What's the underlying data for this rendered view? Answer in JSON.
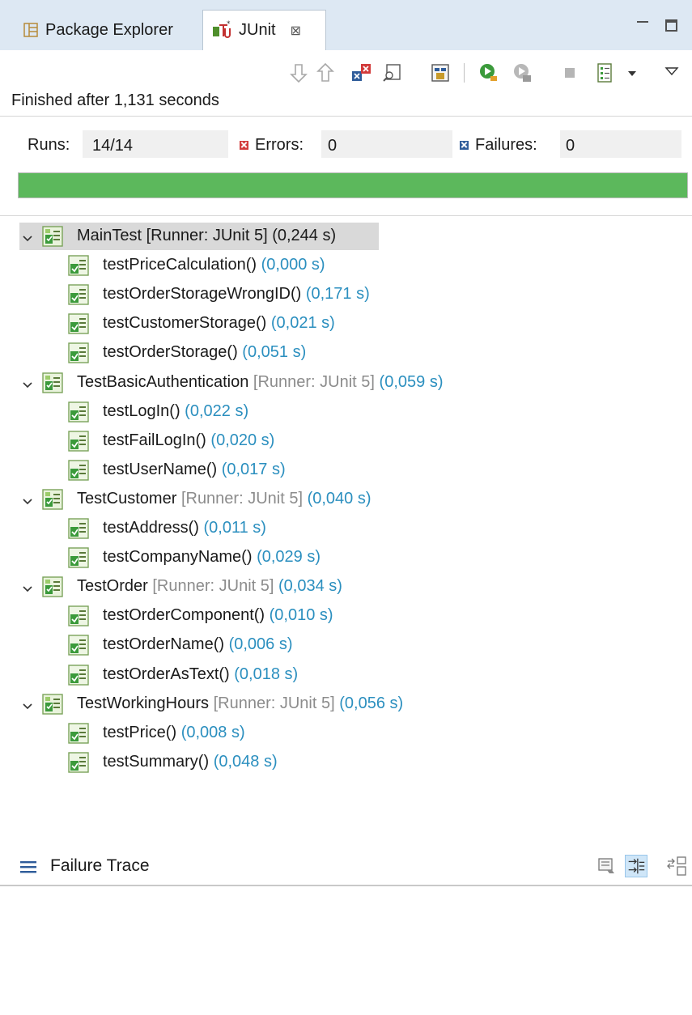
{
  "tabs": {
    "package_explorer": "Package Explorer",
    "junit": "JUnit"
  },
  "status": "Finished after 1,131 seconds",
  "counters": {
    "runs_label": "Runs:",
    "runs_value": "14/14",
    "errors_label": "Errors:",
    "errors_value": "0",
    "failures_label": "Failures:",
    "failures_value": "0"
  },
  "progress": {
    "fraction": 1.0,
    "color": "#5cb85c"
  },
  "colors": {
    "tab_bar": "#dde8f3",
    "duration": "#2b8fbf",
    "runner": "#8c8c8c",
    "error_mark": "#d23a3a",
    "failure_mark": "#2f5c9a"
  },
  "toolbar_icons": [
    "next-failure-icon",
    "previous-failure-icon",
    "show-failures-only-icon",
    "scroll-lock-icon",
    "show-skipped-icon",
    "rerun-test-icon",
    "rerun-failed-first-icon",
    "stop-icon",
    "test-run-history-icon",
    "history-dropdown-icon",
    "view-menu-icon"
  ],
  "tree": [
    {
      "name": "MainTest [Runner: JUnit 5]",
      "time": "(0,244 s)",
      "selected": true,
      "runner_plain": true,
      "cases": [
        {
          "name": "testPriceCalculation()",
          "time": "(0,000 s)"
        },
        {
          "name": "testOrderStorageWrongID()",
          "time": "(0,171 s)"
        },
        {
          "name": "testCustomerStorage()",
          "time": "(0,021 s)"
        },
        {
          "name": "testOrderStorage()",
          "time": "(0,051 s)"
        }
      ]
    },
    {
      "name": "TestBasicAuthentication",
      "runner": "[Runner: JUnit 5]",
      "time": "(0,059 s)",
      "cases": [
        {
          "name": "testLogIn()",
          "time": "(0,022 s)"
        },
        {
          "name": "testFailLogIn()",
          "time": "(0,020 s)"
        },
        {
          "name": "testUserName()",
          "time": "(0,017 s)"
        }
      ]
    },
    {
      "name": "TestCustomer",
      "runner": "[Runner: JUnit 5]",
      "time": "(0,040 s)",
      "cases": [
        {
          "name": "testAddress()",
          "time": "(0,011 s)"
        },
        {
          "name": "testCompanyName()",
          "time": "(0,029 s)"
        }
      ]
    },
    {
      "name": "TestOrder",
      "runner": "[Runner: JUnit 5]",
      "time": "(0,034 s)",
      "cases": [
        {
          "name": "testOrderComponent()",
          "time": "(0,010 s)"
        },
        {
          "name": "testOrderName()",
          "time": "(0,006 s)"
        },
        {
          "name": "testOrderAsText()",
          "time": "(0,018 s)"
        }
      ]
    },
    {
      "name": "TestWorkingHours",
      "runner": "[Runner: JUnit 5]",
      "time": "(0,056 s)",
      "cases": [
        {
          "name": "testPrice()",
          "time": "(0,008 s)"
        },
        {
          "name": "testSummary()",
          "time": "(0,048 s)"
        }
      ]
    }
  ],
  "failure_trace": {
    "label": "Failure Trace"
  }
}
